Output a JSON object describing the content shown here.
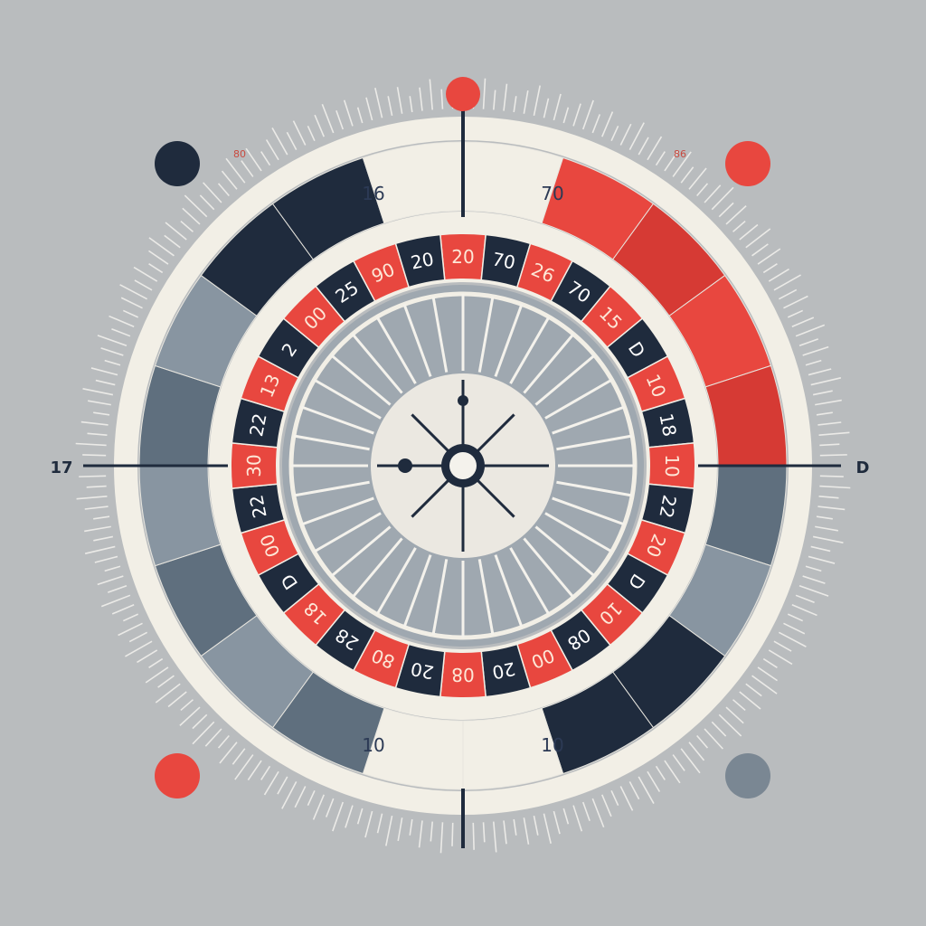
{
  "colors": {
    "background": "#b9bcbe",
    "cream": "#f2efe6",
    "navy": "#1f2b3d",
    "red": "#e8473f",
    "red_dark": "#d63a34",
    "slate": "#5f6f7e",
    "slate_light": "#a3acb4"
  },
  "outer_ring": {
    "top_labels": [
      "16",
      "70"
    ],
    "bottom_labels": [
      "10",
      "10"
    ]
  },
  "number_ring": {
    "pockets": [
      {
        "label": "20",
        "color": "red"
      },
      {
        "label": "70",
        "color": "navy"
      },
      {
        "label": "26",
        "color": "red"
      },
      {
        "label": "70",
        "color": "navy"
      },
      {
        "label": "15",
        "color": "red"
      },
      {
        "label": "D",
        "color": "navy"
      },
      {
        "label": "10",
        "color": "red"
      },
      {
        "label": "18",
        "color": "navy"
      },
      {
        "label": "10",
        "color": "red"
      },
      {
        "label": "22",
        "color": "navy"
      },
      {
        "label": "20",
        "color": "red"
      },
      {
        "label": "D",
        "color": "navy"
      },
      {
        "label": "10",
        "color": "red"
      },
      {
        "label": "08",
        "color": "navy"
      },
      {
        "label": "00",
        "color": "red"
      },
      {
        "label": "20",
        "color": "navy"
      },
      {
        "label": "08",
        "color": "red"
      },
      {
        "label": "20",
        "color": "navy"
      },
      {
        "label": "80",
        "color": "red"
      },
      {
        "label": "28",
        "color": "navy"
      },
      {
        "label": "18",
        "color": "red"
      },
      {
        "label": "D",
        "color": "navy"
      },
      {
        "label": "00",
        "color": "red"
      },
      {
        "label": "22",
        "color": "navy"
      },
      {
        "label": "30",
        "color": "red"
      },
      {
        "label": "22",
        "color": "navy"
      },
      {
        "label": "13",
        "color": "red"
      },
      {
        "label": "2",
        "color": "navy"
      },
      {
        "label": "00",
        "color": "red"
      },
      {
        "label": "25",
        "color": "navy"
      },
      {
        "label": "90",
        "color": "red"
      },
      {
        "label": "20",
        "color": "navy"
      }
    ]
  },
  "markers": {
    "left_label": "17",
    "right_label": "D",
    "top_left_small": "80",
    "top_right_small": "86"
  },
  "dots": {
    "top_left": "navy",
    "top_right": "red",
    "bottom_left": "red",
    "bottom_right": "slate",
    "top_center": "red"
  }
}
